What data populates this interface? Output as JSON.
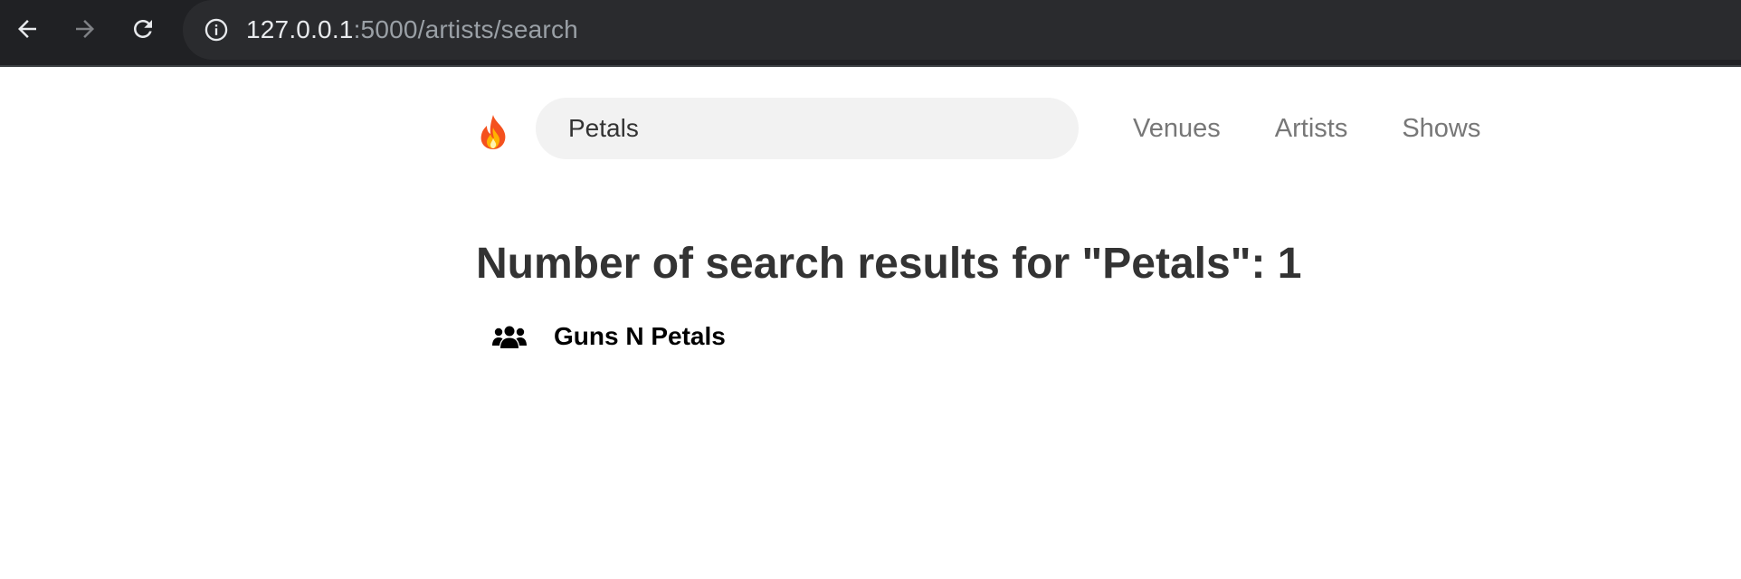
{
  "browser": {
    "url_host": "127.0.0.1",
    "url_rest": ":5000/artists/search",
    "icons": {
      "back": "arrow-left-icon",
      "forward": "arrow-right-icon",
      "reload": "reload-icon",
      "info": "info-icon"
    }
  },
  "header": {
    "logo_icon": "fire-icon",
    "search": {
      "value": "Petals"
    },
    "nav": [
      {
        "label": "Venues"
      },
      {
        "label": "Artists"
      },
      {
        "label": "Shows"
      }
    ]
  },
  "main": {
    "results_title": "Number of search results for \"Petals\": 1",
    "results": [
      {
        "name": "Guns N Petals",
        "icon": "users-icon"
      }
    ]
  },
  "colors": {
    "chrome_bg": "#202124",
    "omnibox_bg": "#2a2b2e",
    "search_bg": "#f2f2f2",
    "nav_text": "#777777",
    "title_text": "#333333"
  }
}
